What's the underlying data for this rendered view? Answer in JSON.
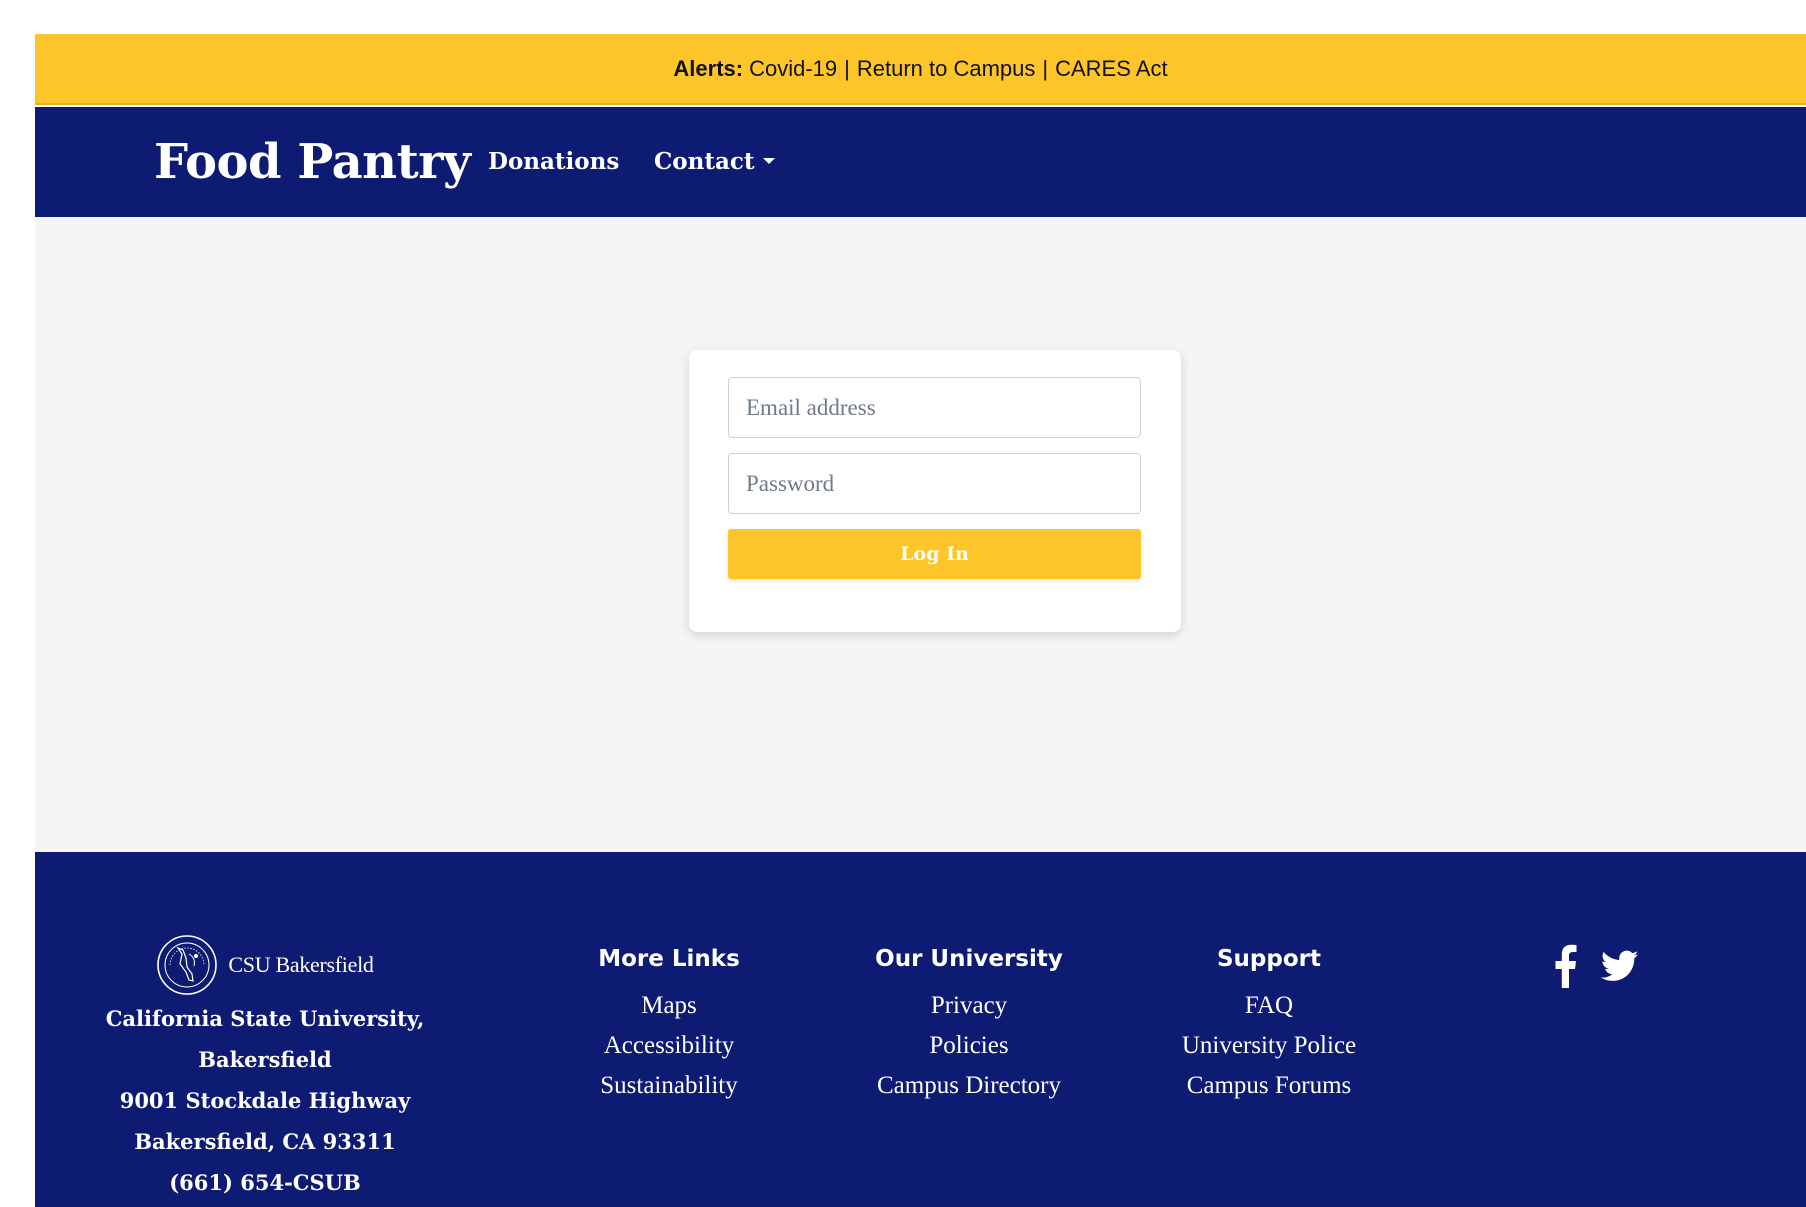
{
  "alert_bar": {
    "label": "Alerts:",
    "links": [
      "Covid-19",
      "Return to Campus",
      "CARES Act"
    ],
    "separator": "|"
  },
  "header": {
    "title": "Food Pantry",
    "nav": {
      "donations": "Donations",
      "contact": "Contact"
    }
  },
  "login": {
    "email_placeholder": "Email address",
    "password_placeholder": "Password",
    "button_label": "Log In"
  },
  "footer": {
    "logo_text": "CSU Bakersfield",
    "address_lines": [
      "California State University,",
      "Bakersfield",
      "9001 Stockdale Highway",
      "Bakersfield, CA 93311",
      "(661) 654-CSUB"
    ],
    "columns": [
      {
        "heading": "More Links",
        "items": [
          "Maps",
          "Accessibility",
          "Sustainability"
        ]
      },
      {
        "heading": "Our University",
        "items": [
          "Privacy",
          "Policies",
          "Campus Directory"
        ]
      },
      {
        "heading": "Support",
        "items": [
          "FAQ",
          "University Police",
          "Campus Forums"
        ]
      }
    ],
    "social_icons": [
      "facebook-icon",
      "twitter-icon"
    ]
  },
  "colors": {
    "alert_yellow": "#fdc52a",
    "navy": "#0e1b72",
    "main_background": "#f4f5f4",
    "white": "#ffffff"
  }
}
